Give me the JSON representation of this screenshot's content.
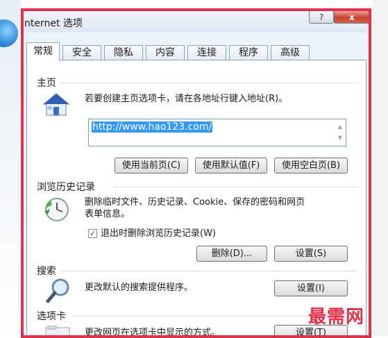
{
  "window": {
    "title": "nternet 选项",
    "help_label": "?",
    "close_label": "x"
  },
  "tabs": [
    {
      "label": "常规",
      "active": true
    },
    {
      "label": "安全"
    },
    {
      "label": "隐私"
    },
    {
      "label": "内容"
    },
    {
      "label": "连接"
    },
    {
      "label": "程序"
    },
    {
      "label": "高级"
    }
  ],
  "home": {
    "section_label": "主页",
    "description": "若要创建主页选项卡，请在各地址行键入地址(R)。",
    "url": "http://www.hao123.com/",
    "buttons": {
      "use_current": "使用当前页(C)",
      "use_default": "使用默认值(F)",
      "use_blank": "使用空白页(B)"
    }
  },
  "history": {
    "section_label": "浏览历史记录",
    "description_line1": "删除临时文件、历史记录、Cookie、保存的密码和网页",
    "description_line2": "表单信息。",
    "checkbox_label": "退出时删除浏览历史记录(W)",
    "checkbox_checked": true,
    "buttons": {
      "delete": "删除(D)...",
      "settings": "设置(S)"
    }
  },
  "search": {
    "section_label": "搜索",
    "description": "更改默认的搜索提供程序。",
    "buttons": {
      "settings": "设置(I)"
    }
  },
  "tabs_section": {
    "section_label": "选项卡",
    "description": "更改网页在选项卡中显示的方式。",
    "buttons": {
      "settings": "设置(T)"
    }
  },
  "watermark": "最需网",
  "colors": {
    "highlight_frame": "#e0324a",
    "selection": "#3399ff"
  }
}
